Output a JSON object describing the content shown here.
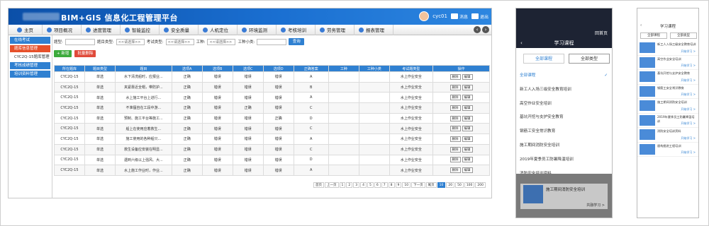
{
  "desktop": {
    "app_title": "BIM+GIS 信息化工程管理平台",
    "user_name": "cyc01",
    "header_msg": "消息",
    "header_exit": "退出",
    "nav": [
      "主页",
      "项目概况",
      "进度管理",
      "智能监控",
      "安全质量",
      "人机定位",
      "环境监测",
      "考核培训",
      "劳务管理",
      "报表管理"
    ],
    "sidebar": {
      "items": [
        {
          "label": "在线考试",
          "active": false
        },
        {
          "label": "题库信息管理",
          "active": true
        },
        {
          "label": "CYC2Q-15题库管理",
          "sub": true
        },
        {
          "label": "考核成绩管理",
          "active": false
        },
        {
          "label": "培训资料管理",
          "active": false
        }
      ]
    },
    "filters": {
      "label1": "题型:",
      "label2": "题目类型:",
      "placeholder2": "<<请选择>>",
      "label3": "考试类型:",
      "placeholder3": "<<请选择>>",
      "label4": "工种:",
      "placeholder4": "<<请选择>>",
      "label5": "工种小类:",
      "search": "查询"
    },
    "actions": {
      "add": "+ 新增",
      "batch_delete": "批量删除"
    },
    "table": {
      "headers": [
        "所在题库",
        "题目类型",
        "题目",
        "选项A",
        "选项B",
        "选项C",
        "选项D",
        "正确答案",
        "工种",
        "工种小类",
        "考试题类型",
        "操作"
      ],
      "rows": [
        [
          "CYC2Q-15",
          "单选",
          "水下清洗船时，应报业...",
          "正确",
          "错误",
          "错误",
          "错误",
          "A",
          "",
          "",
          "水上作业安全",
          ""
        ],
        [
          "CYC2Q-15",
          "单选",
          "夹紧靠近全帽，带防护...",
          "正确",
          "错误",
          "错误",
          "错误",
          "B",
          "",
          "",
          "水上作业安全",
          ""
        ],
        [
          "CYC2Q-15",
          "单选",
          "水上施工平台上进行...",
          "正确",
          "错误",
          "错误",
          "错误",
          "A",
          "",
          "",
          "水上作业安全",
          ""
        ],
        [
          "CYC2Q-15",
          "单选",
          "不准擅自在工段中游...",
          "正确",
          "错误",
          "正确",
          "错误",
          "C",
          "",
          "",
          "水上作业安全",
          ""
        ],
        [
          "CYC2Q-15",
          "单选",
          "预制、施工平台等施工...",
          "正确",
          "错误",
          "错误",
          "正确",
          "D",
          "",
          "",
          "水上作业安全",
          ""
        ],
        [
          "CYC2Q-15",
          "单选",
          "船上在使用应着救生...",
          "正确",
          "错误",
          "错误",
          "错误",
          "C",
          "",
          "",
          "水上作业安全",
          ""
        ],
        [
          "CYC2Q-15",
          "单选",
          "施工使用的各种船只...",
          "正确",
          "错误",
          "错误",
          "错误",
          "A",
          "",
          "",
          "水上作业安全",
          ""
        ],
        [
          "CYC2Q-15",
          "单选",
          "救生设备应安装在明显...",
          "正确",
          "错误",
          "错误",
          "错误",
          "C",
          "",
          "",
          "水上作业安全",
          ""
        ],
        [
          "CYC2Q-15",
          "单选",
          "遇到六级以上强风、大...",
          "正确",
          "错误",
          "错误",
          "错误",
          "D",
          "",
          "",
          "水上作业安全",
          ""
        ],
        [
          "CYC2Q-15",
          "单选",
          "水上施工作业时，作业...",
          "正确",
          "错误",
          "错误",
          "错误",
          "A",
          "",
          "",
          "水上作业安全",
          ""
        ]
      ],
      "op_delete": "删除",
      "op_edit": "编辑"
    },
    "pager": [
      "首页",
      "上一页",
      "1",
      "2",
      "3",
      "4",
      "5",
      "6",
      "7",
      "8",
      "9",
      "10",
      "下一页",
      "尾页",
      "10",
      "20",
      "50",
      "100",
      "200"
    ],
    "pager_current": "10"
  },
  "phone1": {
    "home_label": "回首页",
    "title": "学习课程",
    "filter_all_courses": "全部课程",
    "filter_all_types": "全部类型",
    "list": [
      "全部课程",
      "新工人入场三级安全教育培训",
      "高空作业安全培训",
      "基坑开挖与支护安全教育",
      "钢筋工安全常识教育",
      "施工期间消防安全培训",
      "2019年夏季员工防暑降温培训",
      "消防安全培训资料",
      "盾构掘进工程培训"
    ],
    "card_title": "施工期间消防安全培训",
    "card_more": "共融学习 >"
  },
  "phone2": {
    "title": "学习课程",
    "filter_all_courses": "全部课程",
    "filter_all_types": "全部类型",
    "cards": [
      "新工人入场三级安全教育培训",
      "高空作业安全培训",
      "基坑开挖与支护安全教育",
      "钢筋工安全常识教育",
      "施工期间消防安全培训",
      "2019年夏季员工防暑降温培训",
      "消防安全培训资料",
      "盾构掘进工程培训"
    ],
    "more": "开始学习 >"
  }
}
